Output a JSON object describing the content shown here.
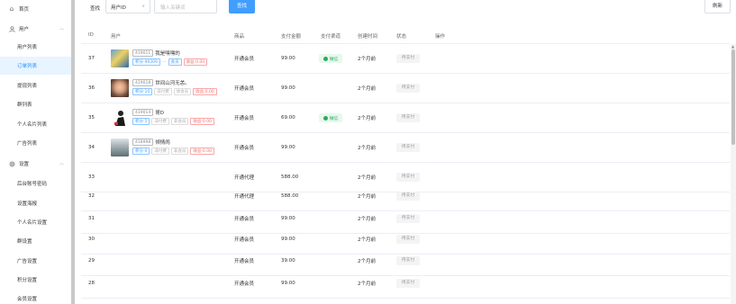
{
  "sidebar": {
    "home": "首页",
    "users_group": "用户",
    "users_items": [
      "用户列表",
      "订单列表",
      "提现列表",
      "群列表",
      "个人名片列表",
      "广告列表"
    ],
    "settings_group": "设置",
    "settings_items": [
      "后台账号密码",
      "设置海报",
      "个人名片设置",
      "群设置",
      "广告设置",
      "积分设置",
      "会员设置"
    ],
    "active_item": "订单列表"
  },
  "toolbar": {
    "search_label": "查找",
    "select_value": "用户ID",
    "search_placeholder": "输入关键词",
    "search_button": "查找",
    "refresh_button": "刷新"
  },
  "table": {
    "headers": [
      "ID",
      "用户",
      "商品",
      "支付金额",
      "支付渠道",
      "创建时间",
      "状态",
      "操作"
    ],
    "rows": [
      {
        "id": "37",
        "uid": "419011",
        "nickname": "我是嘿嘿的",
        "tags": [
          {
            "t": "积分:99309",
            "c": "blue"
          },
          {
            "t": "会员",
            "c": "blue"
          },
          {
            "t": "收益:0.00",
            "c": "red"
          }
        ],
        "has_sep": true,
        "product": "开通会员",
        "amount": "99.00",
        "channel": "微信",
        "created": "2个月前",
        "status": "待支付"
      },
      {
        "id": "36",
        "uid": "419018",
        "nickname": "世间山河无恙。",
        "tags": [
          {
            "t": "积分:10",
            "c": "blue"
          },
          {
            "t": "非付费",
            "c": "gray"
          },
          {
            "t": "体会员",
            "c": "gray"
          },
          {
            "t": "收益:0.00",
            "c": "red"
          }
        ],
        "has_sep": false,
        "product": "开通会员",
        "amount": "99.00",
        "channel": "",
        "created": "2个月前",
        "status": "待支付"
      },
      {
        "id": "35",
        "uid": "419014",
        "nickname": "哥D",
        "tags": [
          {
            "t": "积分:5",
            "c": "blue"
          },
          {
            "t": "非付费",
            "c": "gray"
          },
          {
            "t": "非会员",
            "c": "gray"
          },
          {
            "t": "收益:0.00",
            "c": "red"
          }
        ],
        "has_sep": false,
        "product": "开通会员",
        "amount": "69.00",
        "channel": "微信",
        "created": "2个月前",
        "status": "待支付"
      },
      {
        "id": "34",
        "uid": "418998",
        "nickname": "倾情闹",
        "tags": [
          {
            "t": "积分:0",
            "c": "blue"
          },
          {
            "t": "非付费",
            "c": "gray"
          },
          {
            "t": "非会员",
            "c": "gray"
          },
          {
            "t": "收益:0.00",
            "c": "red"
          }
        ],
        "has_sep": false,
        "product": "开通会员",
        "amount": "99.00",
        "channel": "",
        "created": "2个月前",
        "status": "待支付"
      },
      {
        "id": "33",
        "product": "开通代理",
        "amount": "588.00",
        "created": "2个月前",
        "status": "待支付"
      },
      {
        "id": "32",
        "product": "开通代理",
        "amount": "588.00",
        "created": "2个月前",
        "status": "待支付"
      },
      {
        "id": "31",
        "product": "开通会员",
        "amount": "99.00",
        "created": "2个月前",
        "status": "待支付"
      },
      {
        "id": "30",
        "product": "开通会员",
        "amount": "99.00",
        "created": "2个月前",
        "status": "待支付"
      },
      {
        "id": "29",
        "product": "开通会员",
        "amount": "39.00",
        "created": "2个月前",
        "status": "待支付"
      },
      {
        "id": "28",
        "product": "开通会员",
        "amount": "99.00",
        "created": "2个月前",
        "status": "待支付"
      }
    ]
  },
  "colors": {
    "accent": "#409eff",
    "success": "#2bab5e",
    "danger": "#f56c6c"
  }
}
